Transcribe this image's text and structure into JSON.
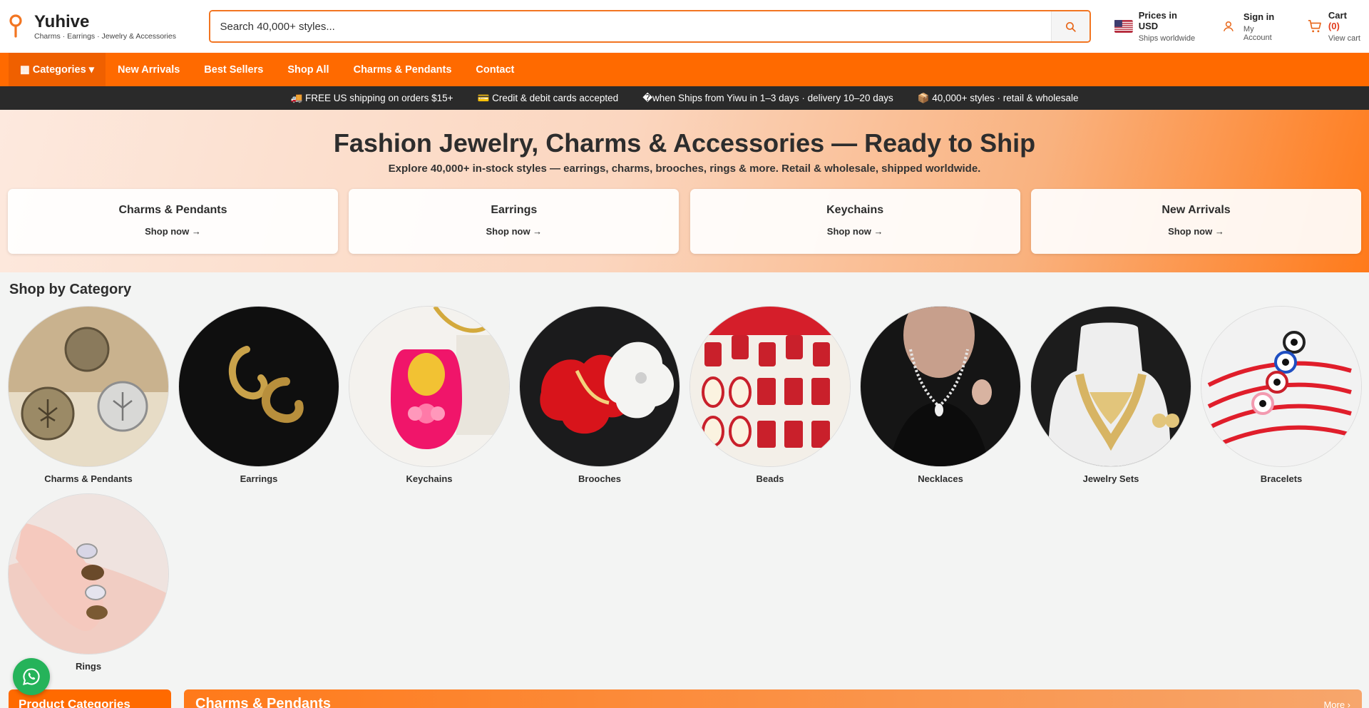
{
  "header": {
    "brand_name": "Yuhive",
    "brand_tagline": "Charms · Earrings · Jewelry & Accessories",
    "search_placeholder": "Search 40,000+ styles...",
    "currency_title": "Prices in USD",
    "currency_sub": "Ships worldwide",
    "signin_title": "Sign in",
    "signin_sub": "My Account",
    "cart_title": "Cart",
    "cart_count": "(0)",
    "cart_sub": "View cart"
  },
  "nav": {
    "categories_label": "▦ Categories ▾",
    "links": [
      "New Arrivals",
      "Best Sellers",
      "Shop All",
      "Charms & Pendants",
      "Contact"
    ]
  },
  "infobar": [
    "🚚 FREE US shipping on orders $15+",
    "💳 Credit & debit cards accepted",
    "�when Ships from Yiwu in 1–3 days · delivery 10–20 days",
    "📦 40,000+ styles · retail & wholesale"
  ],
  "hero": {
    "title": "Fashion Jewelry, Charms & Accessories — Ready to Ship",
    "subtitle": "Explore 40,000+ in-stock styles — earrings, charms, brooches, rings & more. Retail & wholesale, shipped worldwide.",
    "cards": [
      {
        "title": "Charms & Pendants",
        "cta": "Shop now →"
      },
      {
        "title": "Earrings",
        "cta": "Shop now →"
      },
      {
        "title": "Keychains",
        "cta": "Shop now →"
      },
      {
        "title": "New Arrivals",
        "cta": "Shop now →"
      }
    ]
  },
  "categories": {
    "title": "Shop by Category",
    "items": [
      "Charms & Pendants",
      "Earrings",
      "Keychains",
      "Brooches",
      "Beads",
      "Necklaces",
      "Jewelry Sets",
      "Bracelets",
      "Rings"
    ]
  },
  "bottom": {
    "left_title": "Product Categories",
    "right_title": "Charms & Pendants",
    "more": "More ›"
  },
  "colors": {
    "accent": "#ff6a00",
    "dark_bar": "#2a2a2a",
    "whatsapp": "#25b35a"
  }
}
